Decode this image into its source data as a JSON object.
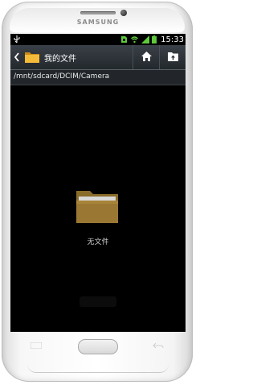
{
  "device": {
    "brand": "SAMSUNG"
  },
  "status_bar": {
    "time": "15:33",
    "icons": [
      "usb-icon",
      "sim-card-icon",
      "wifi-icon",
      "signal-icon",
      "battery-icon"
    ]
  },
  "action_bar": {
    "title": "我的文件",
    "icons": {
      "back": "chevron-left-icon",
      "app": "folder-icon",
      "home": "home-icon",
      "up": "folder-up-icon"
    }
  },
  "path_bar": {
    "path": "/mnt/sdcard/DCIM/Camera"
  },
  "content": {
    "empty_icon": "folder-icon",
    "empty_label": "无文件"
  },
  "colors": {
    "folder": "#e9a92a",
    "screen_background": "#000000",
    "action_bar": "#2b3137"
  }
}
